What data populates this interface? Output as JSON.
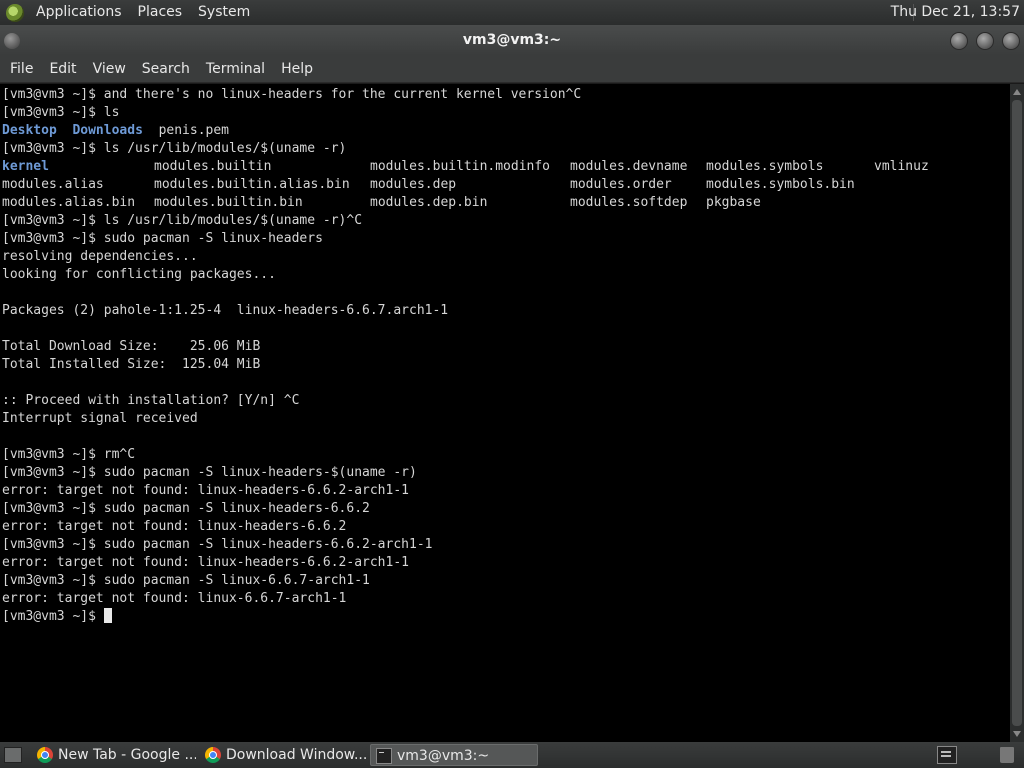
{
  "top_panel": {
    "menus": [
      "Applications",
      "Places",
      "System"
    ],
    "clock": "Thu Dec 21, 13:57"
  },
  "window": {
    "title": "vm3@vm3:~"
  },
  "menubar": [
    "File",
    "Edit",
    "View",
    "Search",
    "Terminal",
    "Help"
  ],
  "terminal": {
    "lines": [
      "[vm3@vm3 ~]$ and there's no linux-headers for the current kernel version^C",
      "[vm3@vm3 ~]$ ls",
      "__LS_DIRS__",
      "[vm3@vm3 ~]$ ls /usr/lib/modules/$(uname -r)",
      "__GRID__",
      "[vm3@vm3 ~]$ ls /usr/lib/modules/$(uname -r)^C",
      "[vm3@vm3 ~]$ sudo pacman -S linux-headers",
      "resolving dependencies...",
      "looking for conflicting packages...",
      "",
      "Packages (2) pahole-1:1.25-4  linux-headers-6.6.7.arch1-1",
      "",
      "Total Download Size:    25.06 MiB",
      "Total Installed Size:  125.04 MiB",
      "",
      ":: Proceed with installation? [Y/n] ^C",
      "Interrupt signal received",
      "",
      "[vm3@vm3 ~]$ rm^C",
      "[vm3@vm3 ~]$ sudo pacman -S linux-headers-$(uname -r)",
      "error: target not found: linux-headers-6.6.2-arch1-1",
      "[vm3@vm3 ~]$ sudo pacman -S linux-headers-6.6.2",
      "error: target not found: linux-headers-6.6.2",
      "[vm3@vm3 ~]$ sudo pacman -S linux-headers-6.6.2-arch1-1",
      "error: target not found: linux-headers-6.6.2-arch1-1",
      "[vm3@vm3 ~]$ sudo pacman -S linux-6.6.7-arch1-1",
      "error: target not found: linux-6.6.7-arch1-1",
      "__PROMPT__"
    ],
    "ls_home": [
      {
        "name": "Desktop",
        "dir": true
      },
      {
        "name": "Downloads",
        "dir": true
      },
      {
        "name": "penis.pem",
        "dir": false
      }
    ],
    "modules_grid": [
      [
        "kernel",
        "modules.builtin",
        "modules.builtin.modinfo",
        "modules.devname",
        "modules.symbols",
        "vmlinuz"
      ],
      [
        "modules.alias",
        "modules.builtin.alias.bin",
        "modules.dep",
        "modules.order",
        "modules.symbols.bin",
        ""
      ],
      [
        "modules.alias.bin",
        "modules.builtin.bin",
        "modules.dep.bin",
        "modules.softdep",
        "pkgbase",
        ""
      ]
    ],
    "prompt": "[vm3@vm3 ~]$ "
  },
  "taskbar": {
    "tasks": [
      {
        "label": "New Tab - Google ...",
        "icon": "chrome-icon",
        "active": false
      },
      {
        "label": "Download Window...",
        "icon": "chrome-icon",
        "active": false
      },
      {
        "label": "vm3@vm3:~",
        "icon": "terminal-icon",
        "active": true
      }
    ]
  },
  "colors": {
    "terminal_bg": "#000000",
    "terminal_fg": "#d6d6d6",
    "directory": "#6e9ad6",
    "panel": "#3a3c3c"
  }
}
